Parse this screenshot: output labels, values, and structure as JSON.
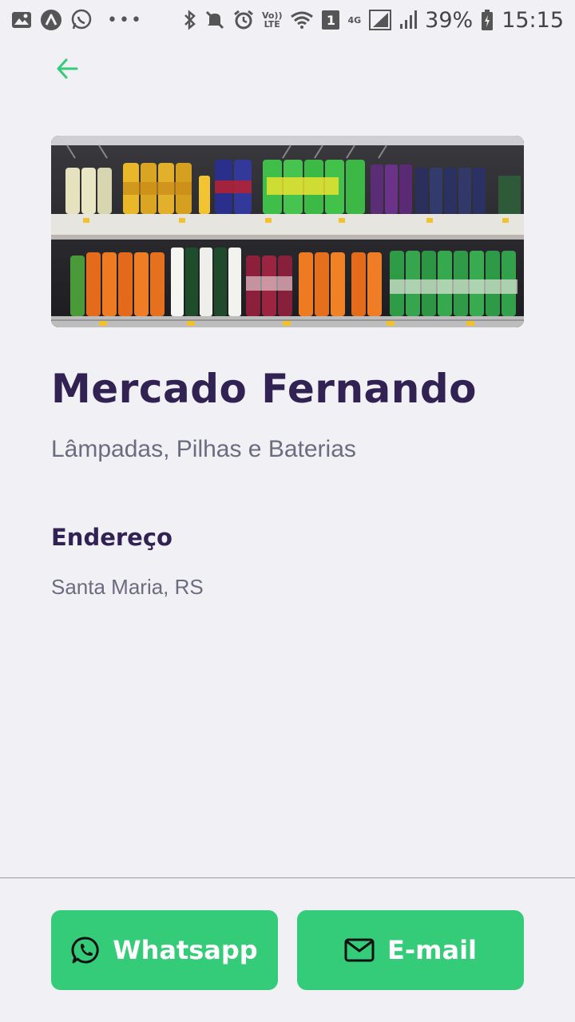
{
  "status_bar": {
    "volte_line1": "Vo))",
    "volte_line2": "LTE",
    "sim_badge": "1",
    "network": "4G",
    "battery": "39%",
    "time": "15:15"
  },
  "detail": {
    "name": "Mercado Fernando",
    "items": "Lâmpadas, Pilhas e Baterias",
    "address_title": "Endereço",
    "address_value": "Santa Maria, RS"
  },
  "footer": {
    "whatsapp_label": "Whatsapp",
    "email_label": "E-mail"
  },
  "colors": {
    "primary": "#34cb79",
    "title": "#322153",
    "text": "#6c6c80",
    "background": "#f0f0f5"
  }
}
